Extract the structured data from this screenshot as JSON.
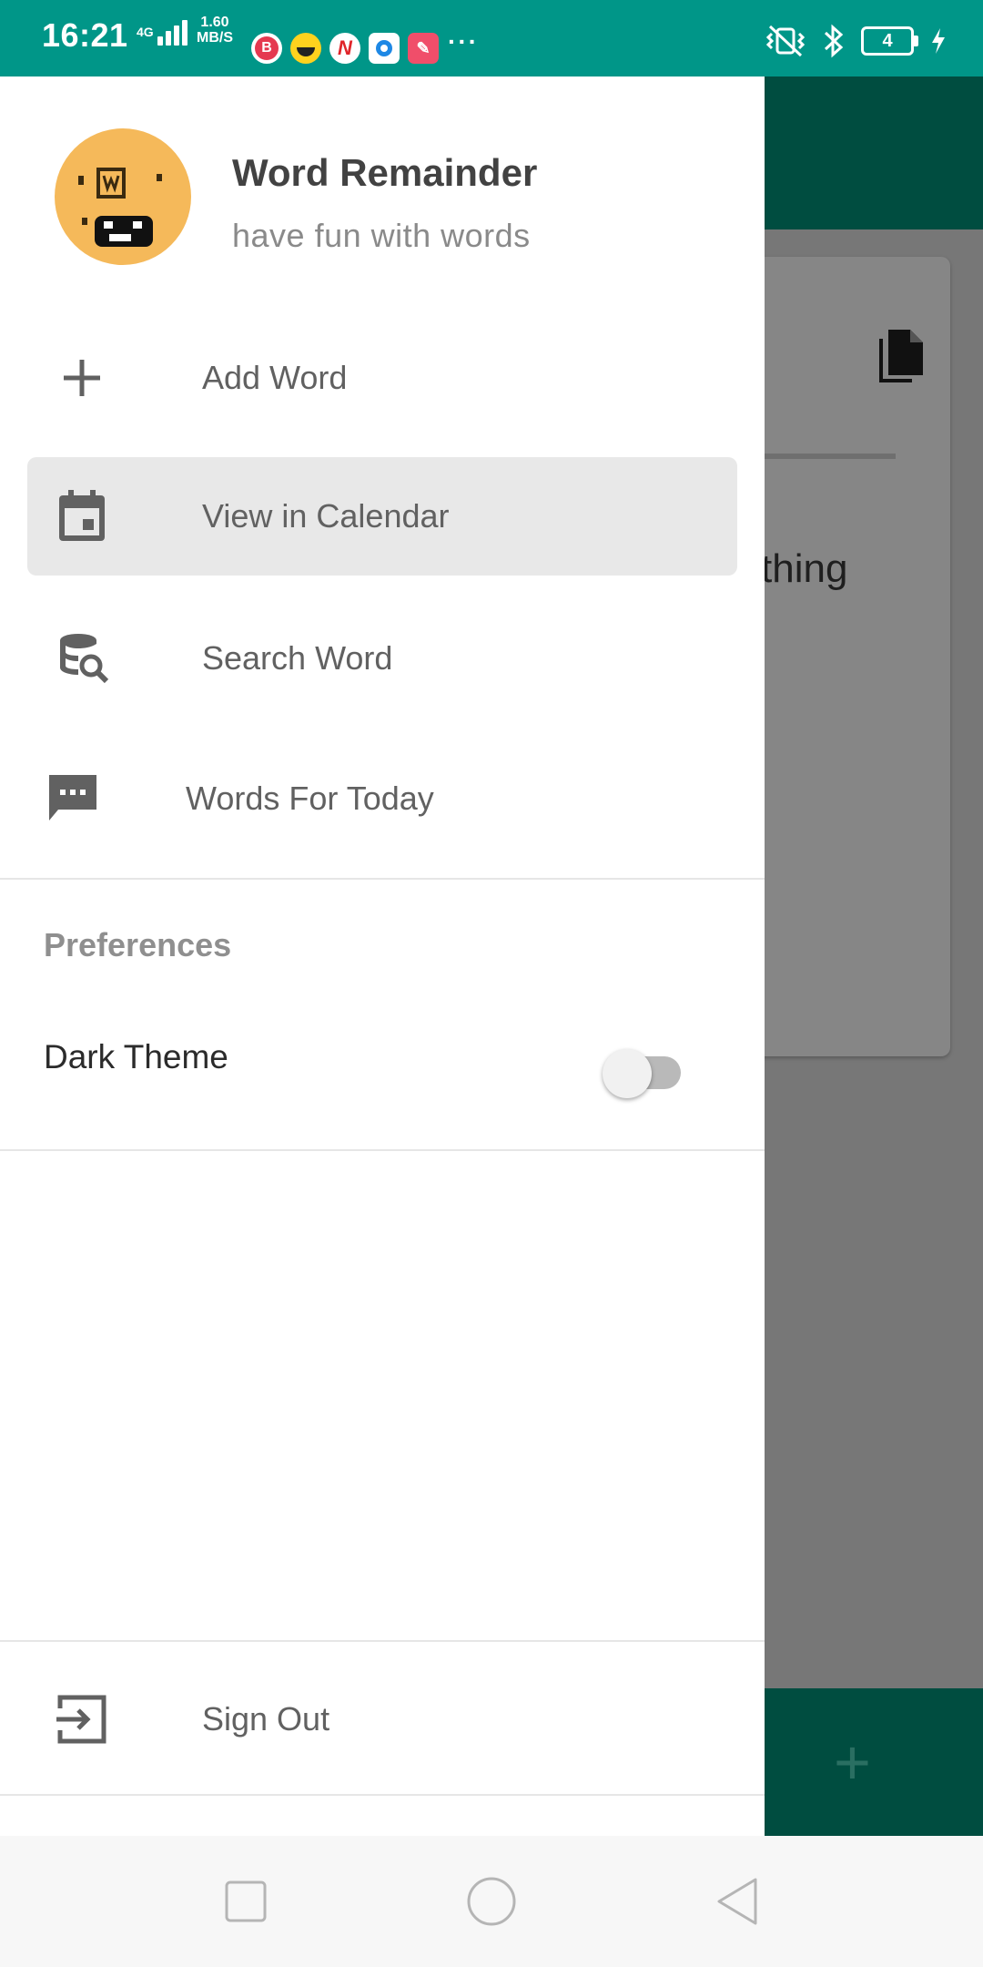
{
  "status_bar": {
    "time": "16:21",
    "network_type": "4G",
    "speed_value": "1.60",
    "speed_unit": "MB/S",
    "more": "···",
    "battery_level": "4"
  },
  "drawer": {
    "app_title": "Word Remainder",
    "app_subtitle": "have fun with words",
    "nav_items": [
      {
        "label": "Add Word",
        "icon": "plus-icon"
      },
      {
        "label": "View in Calendar",
        "icon": "calendar-icon",
        "selected": true
      },
      {
        "label": "Search Word",
        "icon": "database-search-icon"
      },
      {
        "label": "Words For Today",
        "icon": "message-dots-icon"
      }
    ],
    "preferences_title": "Preferences",
    "dark_theme_label": "Dark Theme",
    "dark_theme_enabled": false,
    "sign_out_label": "Sign Out"
  },
  "background": {
    "card_text": "thing"
  },
  "colors": {
    "status_bar": "#009688",
    "app_bar_dim": "#004d40",
    "selected_item": "#e8e8e8"
  }
}
